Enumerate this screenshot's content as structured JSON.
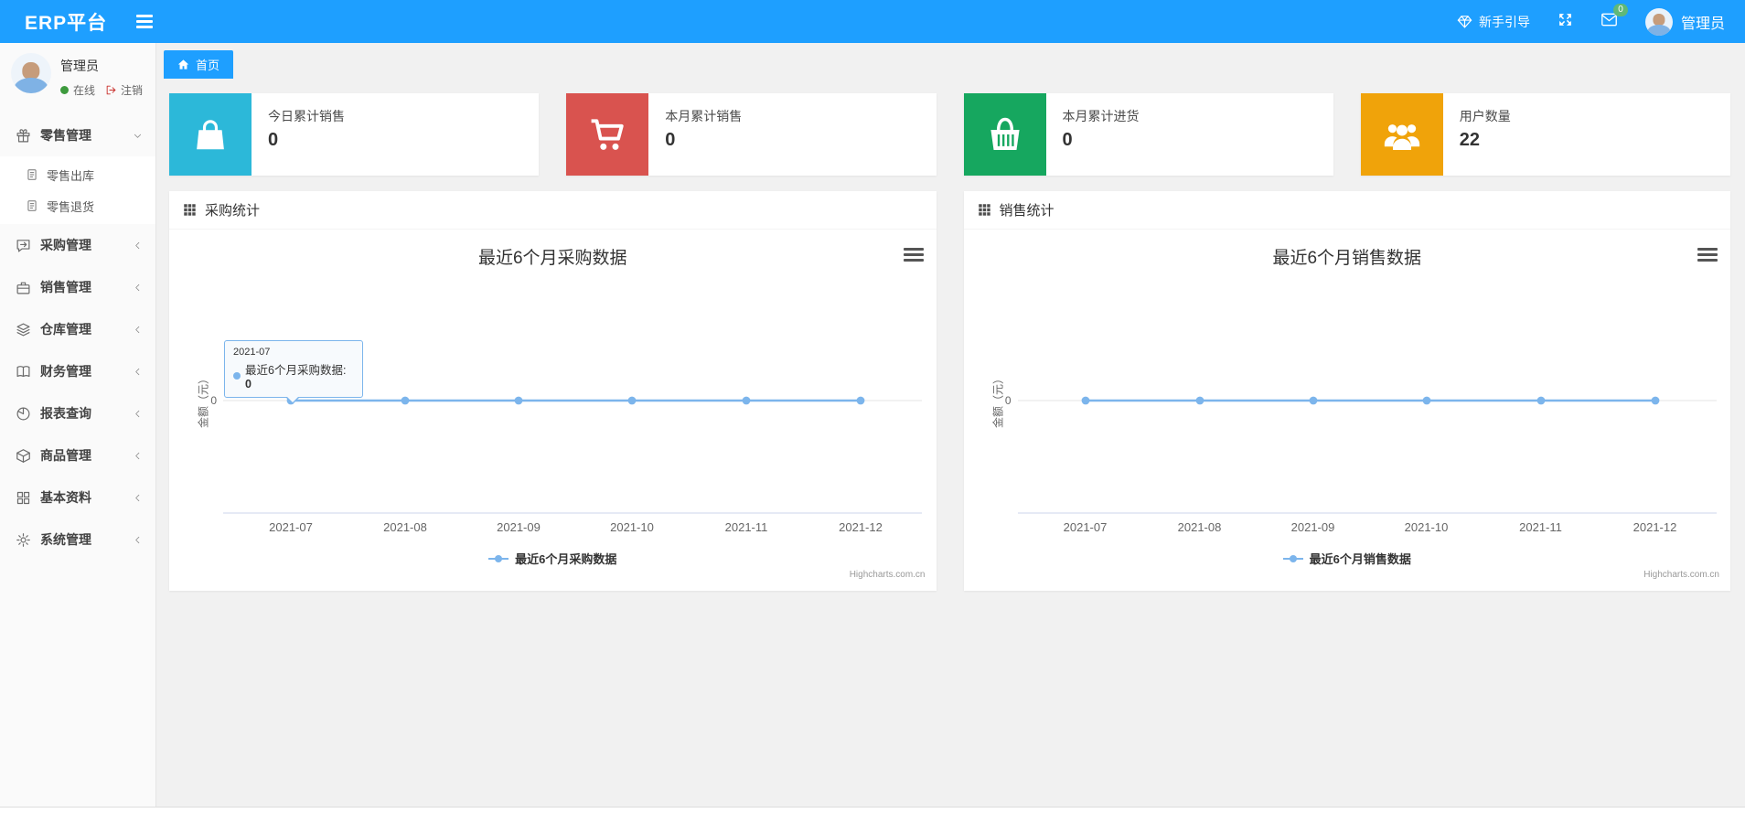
{
  "navbar": {
    "brand": "ERP平台",
    "guide_label": "新手引导",
    "message_count": "0",
    "username": "管理员"
  },
  "sidebar": {
    "user": {
      "name": "管理员",
      "status_label": "在线",
      "logout_label": "注销"
    },
    "menu": [
      {
        "label": "零售管理",
        "icon": "gift-icon",
        "expanded": true,
        "children": [
          {
            "label": "零售出库",
            "icon": "file-icon"
          },
          {
            "label": "零售退货",
            "icon": "file-icon"
          }
        ]
      },
      {
        "label": "采购管理",
        "icon": "chat-square-icon"
      },
      {
        "label": "销售管理",
        "icon": "briefcase-icon"
      },
      {
        "label": "仓库管理",
        "icon": "layers-icon"
      },
      {
        "label": "财务管理",
        "icon": "book-icon"
      },
      {
        "label": "报表查询",
        "icon": "pie-chart-icon"
      },
      {
        "label": "商品管理",
        "icon": "box-icon"
      },
      {
        "label": "基本资料",
        "icon": "grid-icon"
      },
      {
        "label": "系统管理",
        "icon": "gear-icon"
      }
    ]
  },
  "tabs": {
    "home_label": "首页"
  },
  "cards": [
    {
      "label": "今日累计销售",
      "value": "0",
      "color": "#2cb8d9",
      "icon": "shopping-bag-icon"
    },
    {
      "label": "本月累计销售",
      "value": "0",
      "color": "#d9534f",
      "icon": "shopping-cart-icon"
    },
    {
      "label": "本月累计进货",
      "value": "0",
      "color": "#16a75f",
      "icon": "shopping-basket-icon"
    },
    {
      "label": "用户数量",
      "value": "22",
      "color": "#f0a30a",
      "icon": "users-icon"
    }
  ],
  "panels": [
    {
      "header": "采购统计"
    },
    {
      "header": "销售统计"
    }
  ],
  "chart_data": [
    {
      "type": "line",
      "title": "最近6个月采购数据",
      "categories": [
        "2021-07",
        "2021-08",
        "2021-09",
        "2021-10",
        "2021-11",
        "2021-12"
      ],
      "series": [
        {
          "name": "最近6个月采购数据",
          "values": [
            0,
            0,
            0,
            0,
            0,
            0
          ]
        }
      ],
      "ylabel": "金额（元）",
      "ytick": "0",
      "line_color": "#7cb5ec",
      "legend_position": "bottom",
      "grid": "zero-line-only",
      "credits": "Highcharts.com.cn",
      "tooltip": {
        "header": "2021-07",
        "label": "最近6个月采购数据: ",
        "value": "0"
      }
    },
    {
      "type": "line",
      "title": "最近6个月销售数据",
      "categories": [
        "2021-07",
        "2021-08",
        "2021-09",
        "2021-10",
        "2021-11",
        "2021-12"
      ],
      "series": [
        {
          "name": "最近6个月销售数据",
          "values": [
            0,
            0,
            0,
            0,
            0,
            0
          ]
        }
      ],
      "ylabel": "金额（元）",
      "ytick": "0",
      "line_color": "#7cb5ec",
      "legend_position": "bottom",
      "grid": "zero-line-only",
      "credits": "Highcharts.com.cn"
    }
  ]
}
